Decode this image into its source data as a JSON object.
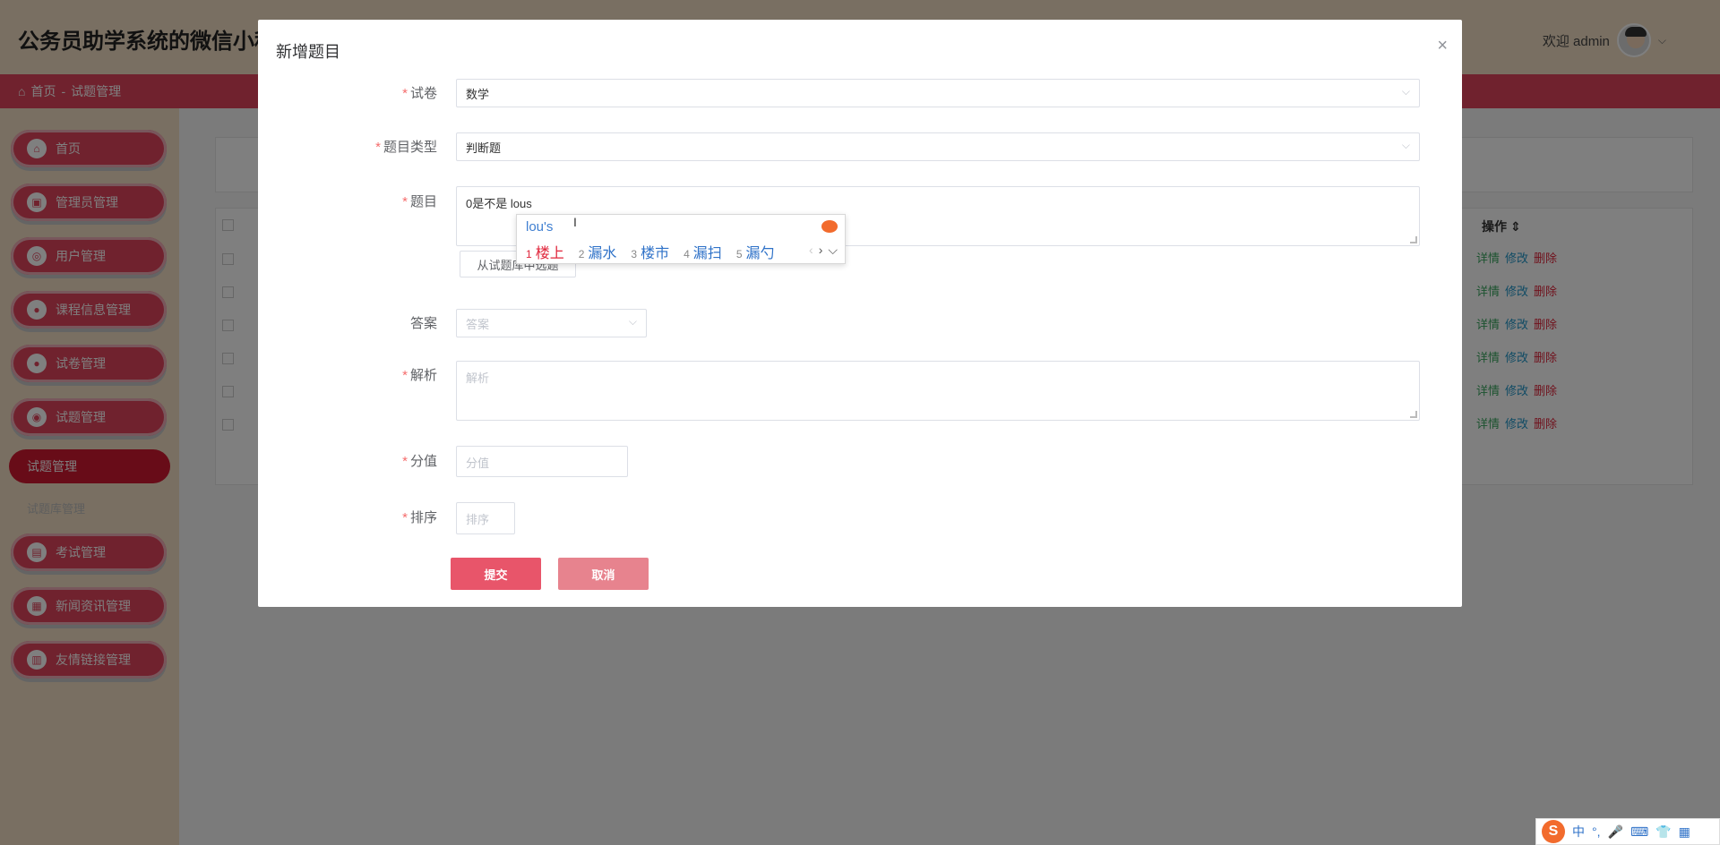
{
  "app": {
    "title": "公务员助学系统的微信小程序",
    "welcome": "欢迎 admin",
    "breadcrumb": {
      "home": "首页",
      "sep": "-",
      "current": "试题管理"
    }
  },
  "sidebar": {
    "items": [
      {
        "label": "首页",
        "icon": "home-icon"
      },
      {
        "label": "管理员管理",
        "icon": "admin-icon"
      },
      {
        "label": "用户管理",
        "icon": "user-icon"
      },
      {
        "label": "课程信息管理",
        "icon": "course-icon"
      },
      {
        "label": "试卷管理",
        "icon": "paper-icon"
      },
      {
        "label": "试题管理",
        "icon": "question-icon"
      }
    ],
    "sub_active": "试题管理",
    "sub_item": "试题库管理",
    "items_after": [
      {
        "label": "考试管理",
        "icon": "exam-icon"
      },
      {
        "label": "新闻资讯管理",
        "icon": "news-icon"
      },
      {
        "label": "友情链接管理",
        "icon": "link-icon"
      }
    ]
  },
  "table": {
    "op_header": "操作",
    "row_actions": {
      "detail": "详情",
      "edit": "修改",
      "delete": "删除"
    },
    "row_count": 6
  },
  "dialog": {
    "title": "新增题目",
    "close": "×",
    "fields": {
      "paper": {
        "label": "试卷",
        "value": "数学"
      },
      "type": {
        "label": "题目类型",
        "value": "判断题"
      },
      "question": {
        "label": "题目",
        "value": "0是不是 lous"
      },
      "pick_button": "从试题库中选题",
      "answer": {
        "label": "答案",
        "placeholder": "答案"
      },
      "analysis": {
        "label": "解析",
        "placeholder": "解析"
      },
      "score": {
        "label": "分值",
        "placeholder": "分值"
      },
      "order": {
        "label": "排序",
        "placeholder": "排序"
      }
    },
    "submit": "提交",
    "cancel": "取消"
  },
  "ime": {
    "composition": "lou's",
    "candidates": [
      {
        "n": "1",
        "text": "楼上"
      },
      {
        "n": "2",
        "text": "漏水"
      },
      {
        "n": "3",
        "text": "楼市"
      },
      {
        "n": "4",
        "text": "漏扫"
      },
      {
        "n": "5",
        "text": "漏勺"
      }
    ],
    "tray": {
      "lang": "中",
      "punct": "°,"
    }
  }
}
